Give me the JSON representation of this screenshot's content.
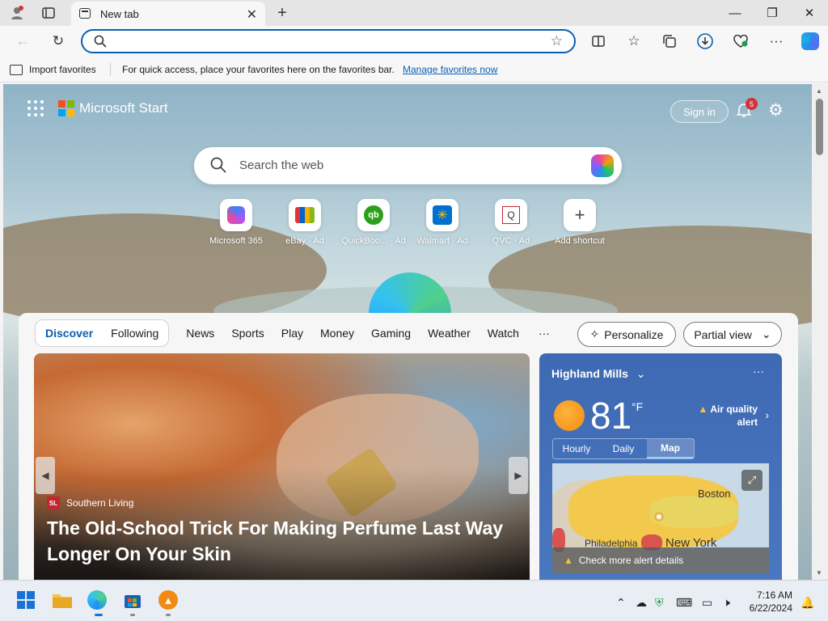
{
  "browser": {
    "tab_title": "New tab",
    "address_value": "",
    "favorites_bar": {
      "import_label": "Import favorites",
      "message": "For quick access, place your favorites here on the favorites bar.",
      "manage_link": "Manage favorites now"
    }
  },
  "header": {
    "brand": "Microsoft Start",
    "signin_label": "Sign in",
    "notification_count": "5"
  },
  "search": {
    "placeholder": "Search the web"
  },
  "shortcuts": [
    {
      "label": "Microsoft 365",
      "icon": "microsoft-365-icon"
    },
    {
      "label": "eBay · Ad",
      "icon": "ebay-icon"
    },
    {
      "label": "QuickBoo... · Ad",
      "icon": "quickbooks-icon"
    },
    {
      "label": "Walmart · Ad",
      "icon": "walmart-icon"
    },
    {
      "label": "QVC · Ad",
      "icon": "qvc-icon"
    },
    {
      "label": "Add shortcut",
      "icon": "plus-icon"
    }
  ],
  "feed": {
    "segment": [
      "Discover",
      "Following"
    ],
    "tabs": [
      "News",
      "Sports",
      "Play",
      "Money",
      "Gaming",
      "Weather",
      "Watch"
    ],
    "more_label": "···",
    "personalize_label": "Personalize",
    "view_label": "Partial view"
  },
  "article": {
    "source": "Southern Living",
    "source_logo_text": "SL",
    "headline": "The Old-School Trick For Making Perfume Last Way Longer On Your Skin"
  },
  "weather": {
    "location": "Highland Mills",
    "temperature": "81",
    "unit": "°F",
    "alert": "Air quality alert",
    "tabs": [
      "Hourly",
      "Daily",
      "Map"
    ],
    "active_tab": "Map",
    "map_labels": [
      "Boston",
      "Philadelphia",
      "New York"
    ],
    "map_alert": "Check more alert details"
  },
  "taskbar": {
    "time": "7:16 AM",
    "date": "6/22/2024"
  },
  "colors": {
    "accent": "#0a5fb4",
    "weather_bg": "#3e69b3",
    "badge_red": "#d13438"
  }
}
